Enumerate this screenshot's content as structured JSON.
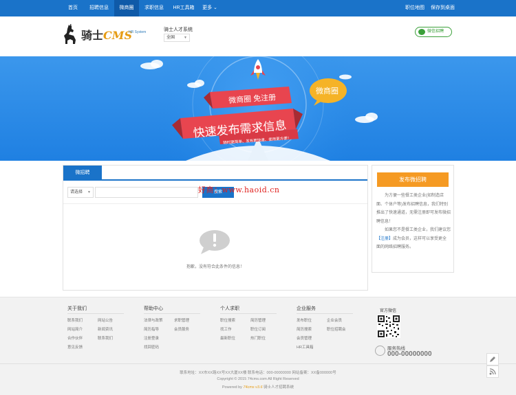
{
  "topnav": {
    "items": [
      "首页",
      "招聘信息",
      "微商圈",
      "求职信息",
      "HR工具箱",
      "更多"
    ],
    "active_index": 2,
    "more_caret": "⌄",
    "right_links": [
      "职位地图",
      "保存到桌面"
    ]
  },
  "header": {
    "logo_main": "骑士",
    "logo_cms": "CMS",
    "logo_sub": "HR System",
    "site_name": "骑士人才系统",
    "city": "全国",
    "wechat_label": "微信招聘"
  },
  "banner": {
    "ribbon_top": "微商圈    免注册",
    "ribbon_main": "快速发布需求信息",
    "ribbon_small": "随时更简单、发布更快速、使用更方便！",
    "bubble": "微商圈",
    "colors": {
      "sky": "#2489e6",
      "ribbon": "#e8454f",
      "bubble": "#f5b327"
    }
  },
  "main": {
    "tab_label": "微招聘",
    "filter_label": "请选择",
    "search_placeholder": "",
    "search_button": "搜索",
    "watermark": "好商：www.haoid.cn",
    "empty_text": "抱歉，没有符合此条件的信息！"
  },
  "side": {
    "publish_button": "发布微招聘",
    "para1": "为方便一些餐工类企业(如制造店面、个体户等)发布招聘信息，我们特别推出了快速通道，无需注册即可发布微招聘信息！",
    "para2_pre": "如果您不是餐工类企业，我们建议您",
    "para2_link": "【注册】",
    "para2_post": "成为会员，这样可以享受更全面的网络招聘服务。"
  },
  "footer": {
    "columns": [
      {
        "title": "关于我们",
        "links": [
          "联系我们",
          "网站公告",
          "网站简介",
          "新闻资讯",
          "合作伙伴",
          "联系我们",
          "意见反馈"
        ]
      },
      {
        "title": "帮助中心",
        "links": [
          "法律与政策",
          "求职管理",
          "简历指导",
          "会员服务",
          "注册登录",
          "找回密码"
        ]
      },
      {
        "title": "个人求职",
        "links": [
          "职位搜索",
          "简历管理",
          "找工作",
          "职位订阅",
          "最新职位",
          "热门职位"
        ]
      },
      {
        "title": "企业服务",
        "links": [
          "发布职位",
          "企业会员",
          "简历搜索",
          "职位招聘会",
          "会员管理",
          "HR工具箱"
        ]
      }
    ],
    "qr_title": "官方微信",
    "hotline_label": "服务热线",
    "hotline_number": "000-00000000",
    "copyright_1": "联系地址：XX市XX路XX号XX大厦XX楼  联系电话：000-00000000  网站备案：XX备000000号",
    "copyright_2": "Copyright © 2015 74cms.com All Right Reserved",
    "powered_pre": "Powered by ",
    "powered_brand": "74cms v3.6",
    "powered_post": " 骑士人才招聘系统"
  },
  "side_tools": [
    "edit-icon",
    "rss-icon"
  ]
}
